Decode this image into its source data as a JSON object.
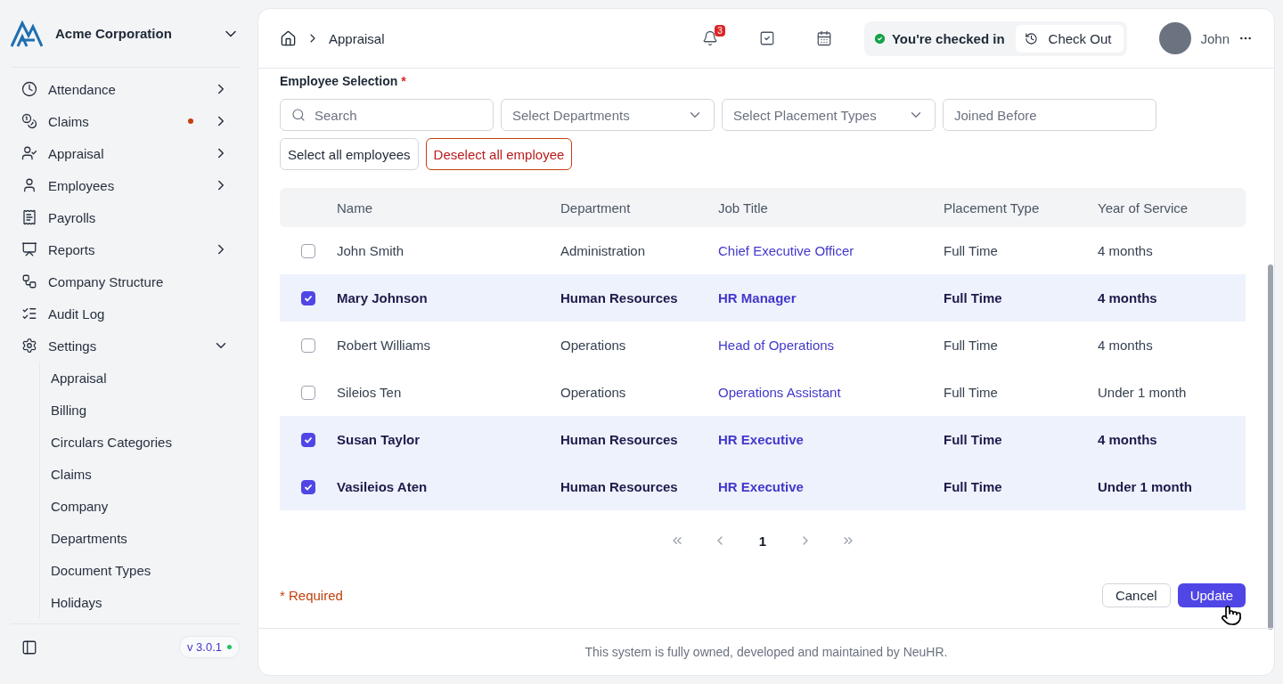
{
  "company": {
    "name": "Acme Corporation"
  },
  "sidebar": {
    "items": [
      {
        "label": "Attendance",
        "kind": "group",
        "expanded": false,
        "notification": false
      },
      {
        "label": "Claims",
        "kind": "group",
        "expanded": false,
        "notification": true
      },
      {
        "label": "Appraisal",
        "kind": "group",
        "expanded": false,
        "notification": false
      },
      {
        "label": "Employees",
        "kind": "group",
        "expanded": false,
        "notification": false
      },
      {
        "label": "Payrolls",
        "kind": "link",
        "notification": false
      },
      {
        "label": "Reports",
        "kind": "group",
        "expanded": false,
        "notification": false
      },
      {
        "label": "Company Structure",
        "kind": "link",
        "notification": false
      },
      {
        "label": "Audit Log",
        "kind": "link",
        "notification": false
      },
      {
        "label": "Settings",
        "kind": "group",
        "expanded": true,
        "notification": false,
        "children": [
          {
            "label": "Appraisal"
          },
          {
            "label": "Billing"
          },
          {
            "label": "Circulars Categories"
          },
          {
            "label": "Claims"
          },
          {
            "label": "Company"
          },
          {
            "label": "Departments"
          },
          {
            "label": "Document Types"
          },
          {
            "label": "Holidays"
          }
        ]
      }
    ],
    "version": "v 3.0.1"
  },
  "header": {
    "breadcrumb": [
      "Appraisal"
    ],
    "notification_count": "3",
    "checkin_status": "You're checked in",
    "checkout_label": "Check Out",
    "user": "John"
  },
  "form": {
    "label": "Employee Selection",
    "required_mark": "*",
    "filters": [
      {
        "kind": "search",
        "placeholder": "Search"
      },
      {
        "kind": "select",
        "placeholder": "Select Departments"
      },
      {
        "kind": "select",
        "placeholder": "Select Placement Types"
      },
      {
        "kind": "date",
        "placeholder": "Joined Before"
      }
    ],
    "buttons": [
      {
        "label": "Select all employees",
        "kind": "neutral"
      },
      {
        "label": "Deselect all employee",
        "kind": "danger"
      }
    ]
  },
  "table": {
    "columns": [
      "Name",
      "Department",
      "Job Title",
      "Placement Type",
      "Year of Service"
    ],
    "rows": [
      {
        "selected": false,
        "cells": [
          "John Smith",
          "Administration",
          "Chief Executive Officer",
          "Full Time",
          "4 months"
        ]
      },
      {
        "selected": true,
        "cells": [
          "Mary Johnson",
          "Human Resources",
          "HR Manager",
          "Full Time",
          "4 months"
        ]
      },
      {
        "selected": false,
        "cells": [
          "Robert Williams",
          "Operations",
          "Head of Operations",
          "Full Time",
          "4 months"
        ]
      },
      {
        "selected": false,
        "cells": [
          "Sileios Ten",
          "Operations",
          "Operations Assistant",
          "Full Time",
          "Under 1 month"
        ]
      },
      {
        "selected": true,
        "cells": [
          "Susan Taylor",
          "Human Resources",
          "HR Executive",
          "Full Time",
          "4 months"
        ]
      },
      {
        "selected": true,
        "cells": [
          "Vasileios Aten",
          "Human Resources",
          "HR Executive",
          "Full Time",
          "Under 1 month"
        ]
      }
    ]
  },
  "pagination": {
    "pages": [
      {
        "label": "1",
        "selected": true
      }
    ]
  },
  "footer_form": {
    "required_note": "* Required",
    "cancel": "Cancel",
    "update": "Update"
  },
  "footer": {
    "text": "This system is fully owned, developed and maintained by NeuHR."
  }
}
